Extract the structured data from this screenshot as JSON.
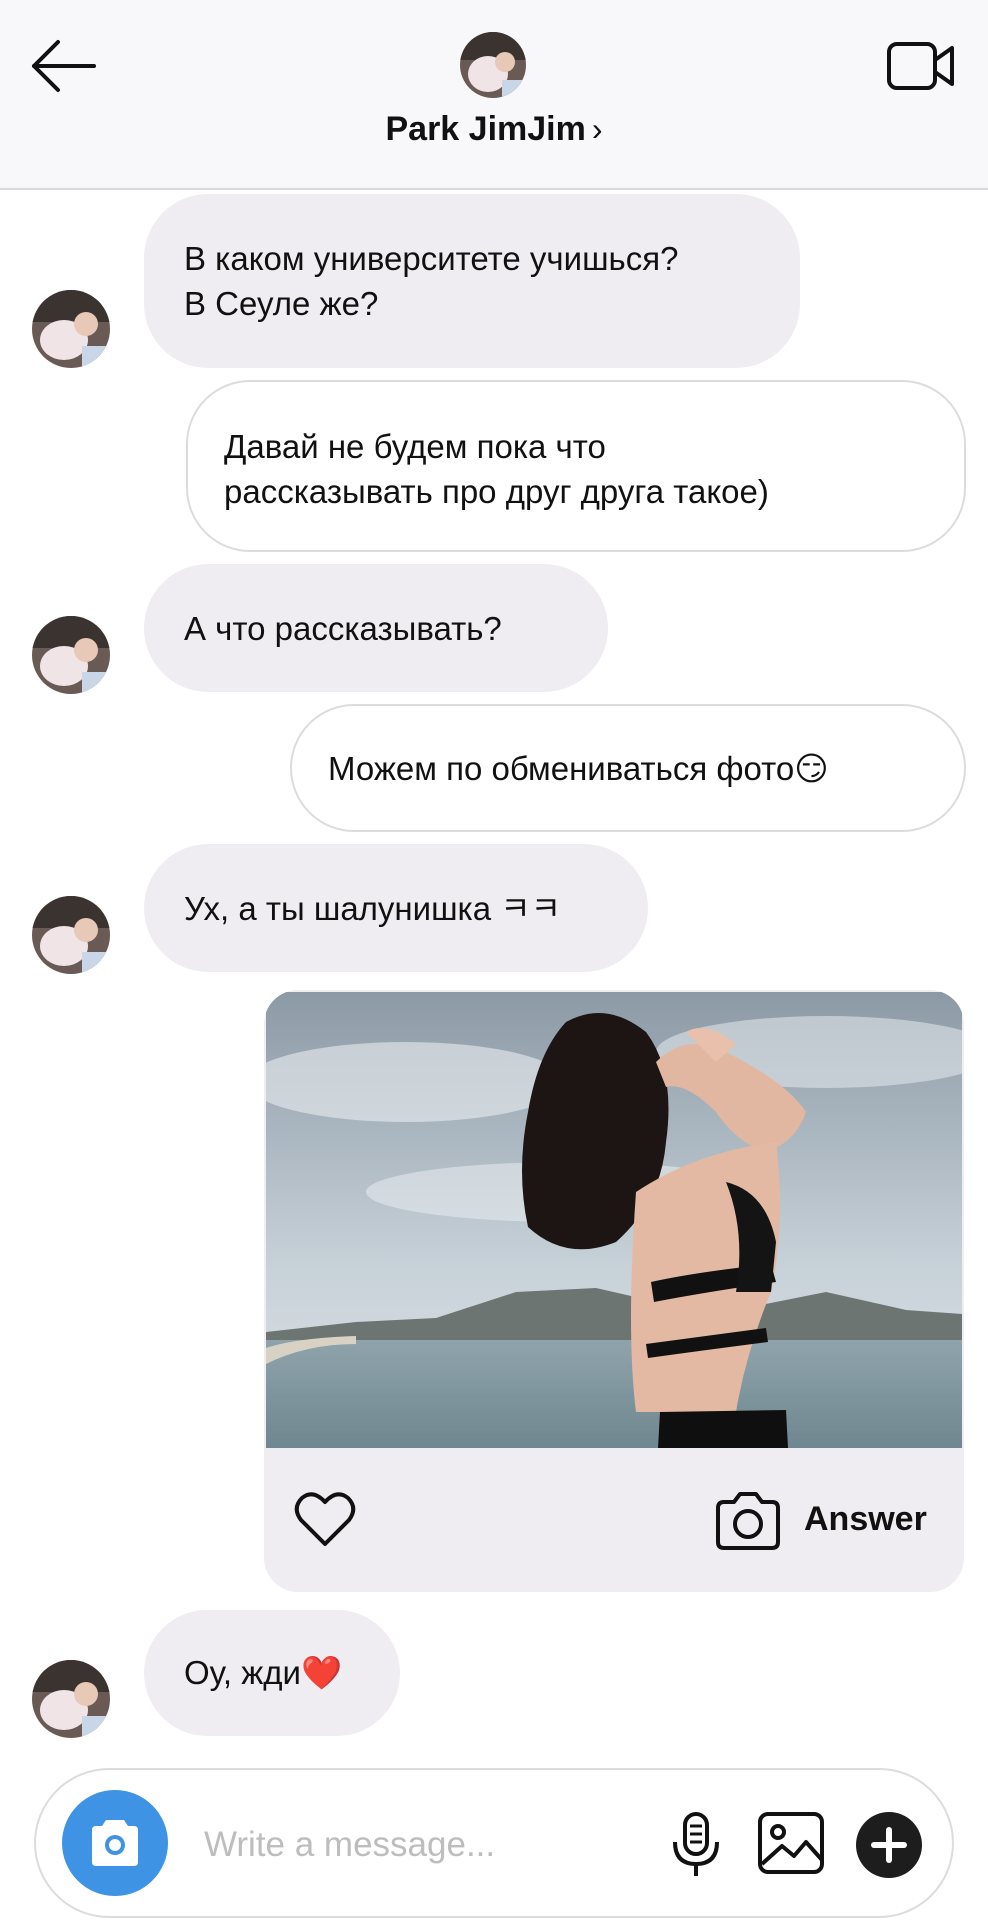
{
  "header": {
    "contact_name": "Park JimJim",
    "chevron": "›",
    "icons": {
      "back": "arrow-left-icon",
      "video": "video-call-icon"
    }
  },
  "messages": [
    {
      "direction": "in",
      "text_line1": "В каком университете учишься?",
      "text_line2": "В Сеуле же?"
    },
    {
      "direction": "out",
      "text_line1": "Давай не будем пока что",
      "text_line2": "рассказывать про друг друга такое)"
    },
    {
      "direction": "in",
      "text": "А что рассказывать?"
    },
    {
      "direction": "out",
      "text": "Можем по обмениваться фото😏"
    },
    {
      "direction": "in",
      "text": "Ух, а ты шалунишка ㅋㅋ"
    },
    {
      "direction": "out",
      "type": "photo",
      "answer_label": "Answer"
    },
    {
      "direction": "in",
      "text": "Оу, жди❤️"
    }
  ],
  "composer": {
    "placeholder": "Write a message...",
    "value": "",
    "icons": {
      "camera": "camera-icon",
      "mic": "microphone-icon",
      "gallery": "image-icon",
      "plus": "plus-icon"
    }
  },
  "colors": {
    "incoming_bubble": "#efedf1",
    "outgoing_border": "#dcdcdc",
    "camera_button": "#3f93e4",
    "header_bg": "#f8f7f9"
  }
}
